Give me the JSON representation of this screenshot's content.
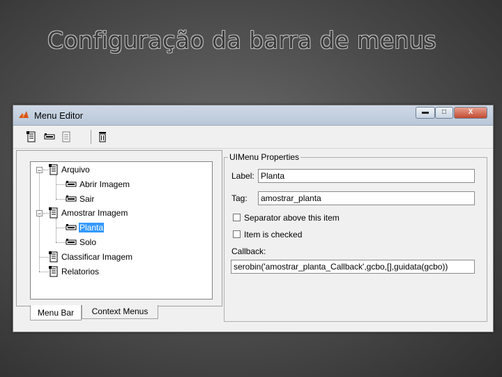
{
  "slide": {
    "title": "Configuração da barra de menus"
  },
  "window": {
    "title": "Menu Editor",
    "controls": {
      "minimize": "▬",
      "maximize": "□",
      "close": "X"
    }
  },
  "toolbar": {
    "icons": [
      "new-menu-icon",
      "new-menu-item-icon",
      "new-context-menu-icon",
      "delete-icon"
    ]
  },
  "tree": {
    "nodes": [
      {
        "label": "Arquivo",
        "level": 0,
        "expanded": true,
        "icon": "menu-icon"
      },
      {
        "label": "Abrir Imagem",
        "level": 1,
        "icon": "menu-item-icon"
      },
      {
        "label": "Sair",
        "level": 1,
        "icon": "menu-item-icon"
      },
      {
        "label": "Amostrar Imagem",
        "level": 0,
        "expanded": true,
        "icon": "menu-icon"
      },
      {
        "label": "Planta",
        "level": 1,
        "selected": true,
        "icon": "menu-item-icon"
      },
      {
        "label": "Solo",
        "level": 1,
        "icon": "menu-item-icon"
      },
      {
        "label": "Classificar Imagem",
        "level": 0,
        "icon": "menu-icon"
      },
      {
        "label": "Relatorios",
        "level": 0,
        "icon": "menu-icon"
      }
    ]
  },
  "tabs": {
    "menu_bar": "Menu Bar",
    "context_menus": "Context Menus"
  },
  "properties": {
    "legend": "UIMenu Properties",
    "label_caption": "Label:",
    "label_value": "Planta",
    "tag_caption": "Tag:",
    "tag_value": "amostrar_planta",
    "separator_label": "Separator above this item",
    "separator_checked": false,
    "checked_label": "Item is checked",
    "checked_checked": false,
    "callback_caption": "Callback:",
    "callback_value": "serobin('amostrar_planta_Callback',gcbo,[],guidata(gcbo))"
  },
  "colors": {
    "selection": "#3399ff",
    "titlebar": "#c4d0df",
    "background": "#4a4a4a"
  }
}
